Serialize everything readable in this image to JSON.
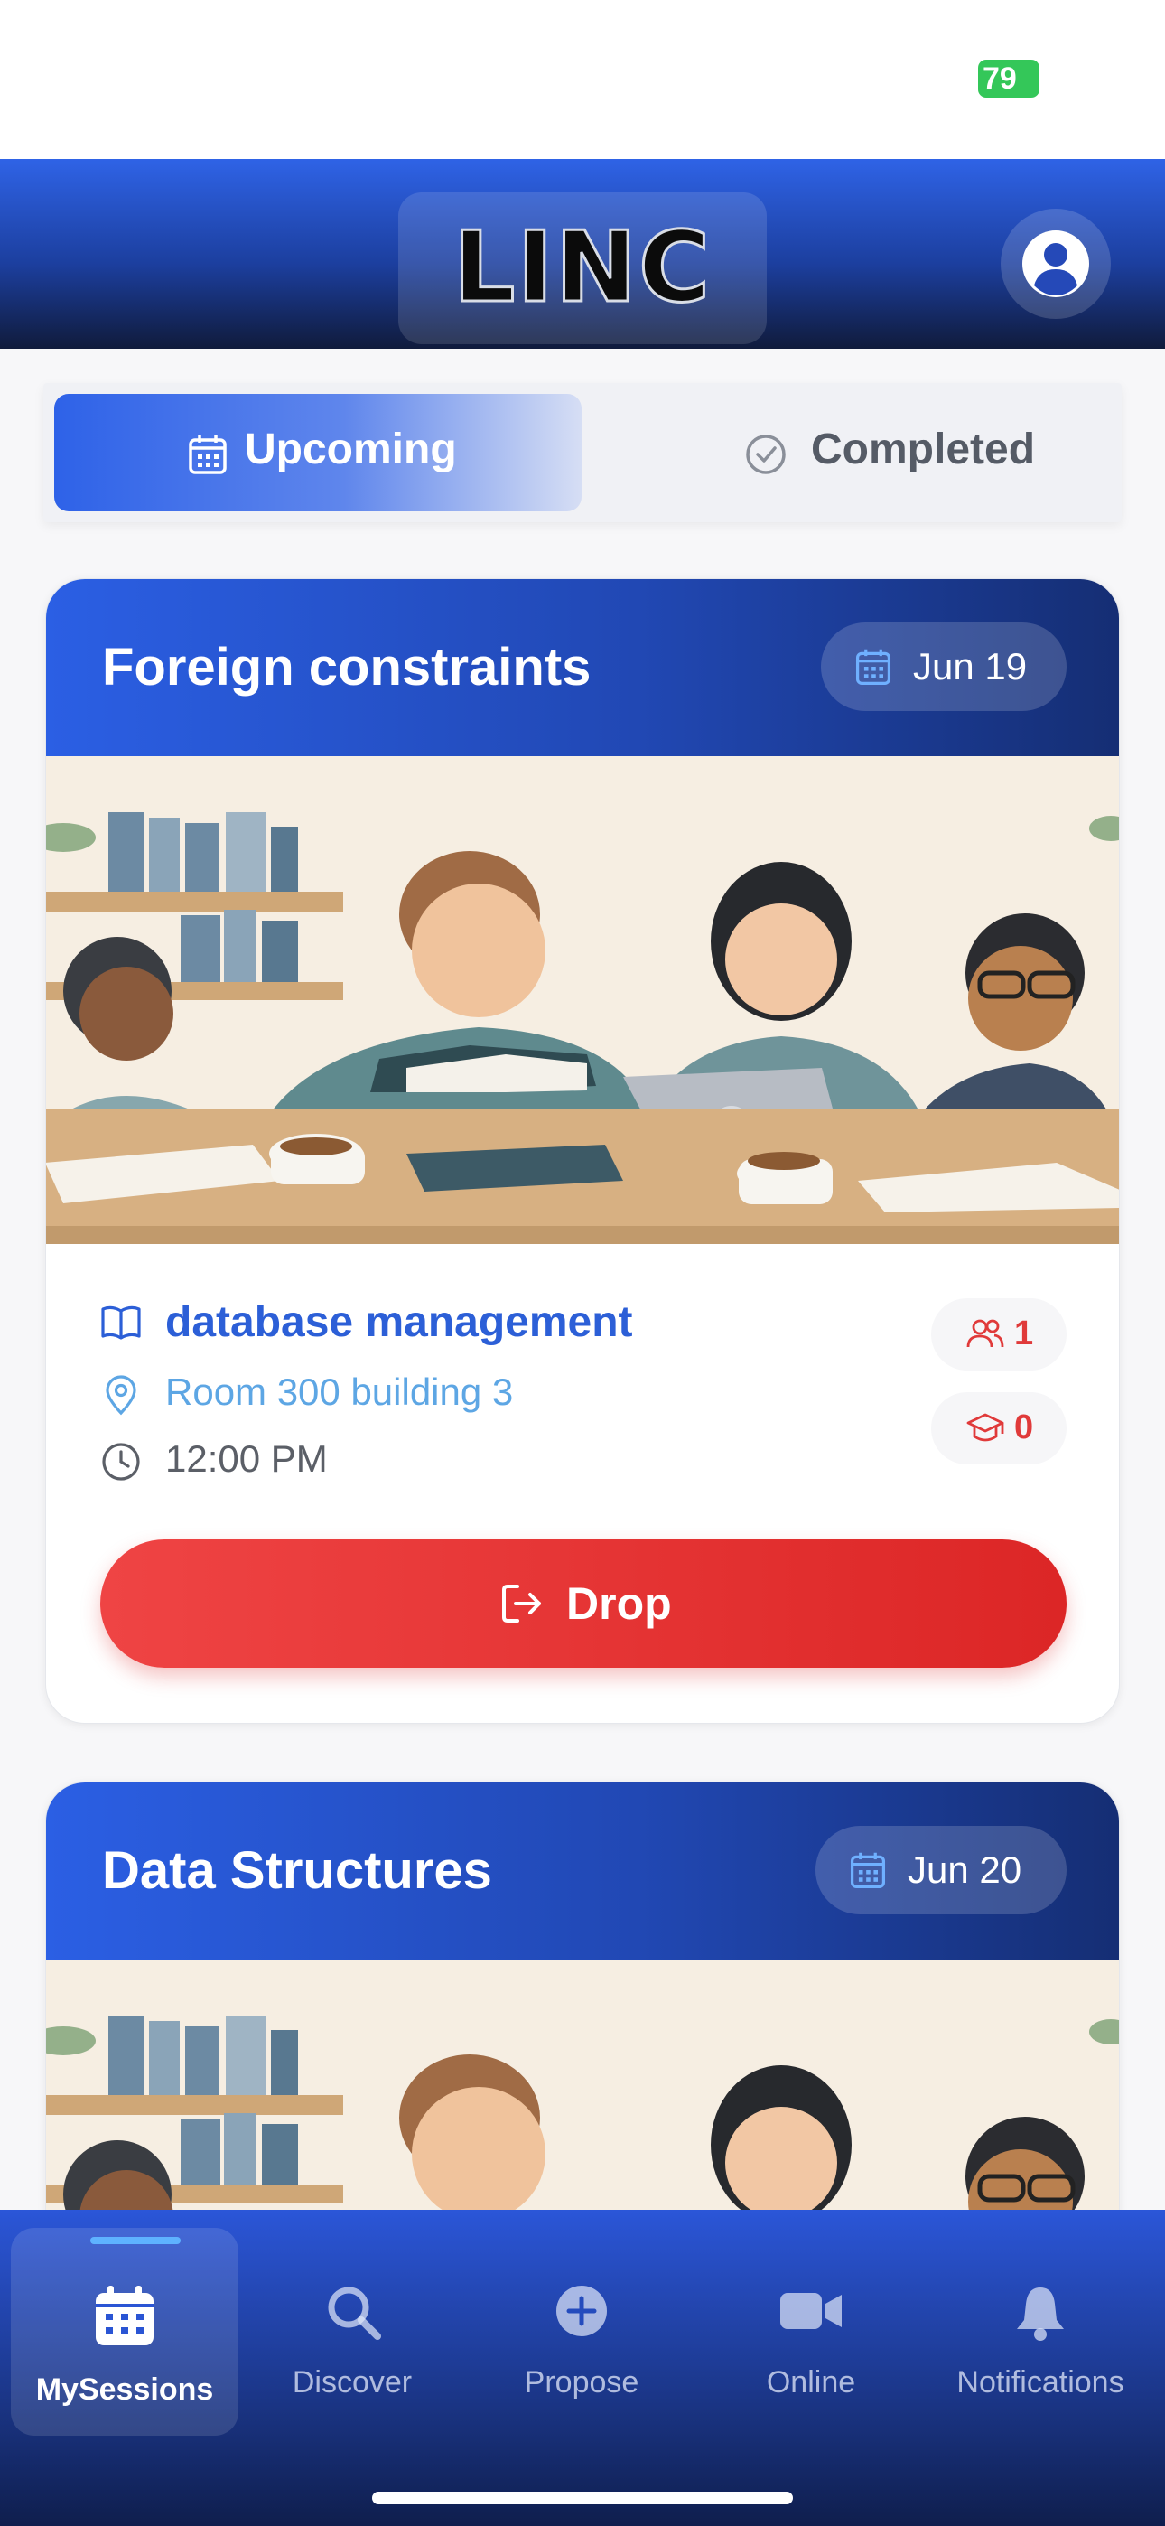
{
  "status_bar": {
    "battery": "79"
  },
  "header": {
    "logo": "LINC",
    "profile_icon": "user-circle-icon"
  },
  "tabs": [
    {
      "label": "Upcoming",
      "icon": "calendar-icon",
      "active": true
    },
    {
      "label": "Completed",
      "icon": "check-circle-icon",
      "active": false
    }
  ],
  "sessions": [
    {
      "title": "Foreign constraints",
      "date": "Jun 19",
      "subject": "database management",
      "location": "Room 300 building 3",
      "time": "12:00 PM",
      "participants": "1",
      "tutors": "0",
      "action_label": "Drop"
    },
    {
      "title": "Data Structures",
      "date": "Jun 20"
    }
  ],
  "bottom_nav": [
    {
      "label": "MySessions",
      "icon": "calendar-icon",
      "active": true
    },
    {
      "label": "Discover",
      "icon": "search-icon",
      "active": false
    },
    {
      "label": "Propose",
      "icon": "plus-circle-icon",
      "active": false
    },
    {
      "label": "Online",
      "icon": "video-icon",
      "active": false
    },
    {
      "label": "Notifications",
      "icon": "bell-icon",
      "active": false
    }
  ],
  "colors": {
    "primary": "#2e62e8",
    "header_dark": "#101b3c",
    "danger": "#dc2626",
    "subject_text": "#2c5fd7",
    "location_text": "#5da6e4",
    "online_dot": "#3ed37a"
  }
}
